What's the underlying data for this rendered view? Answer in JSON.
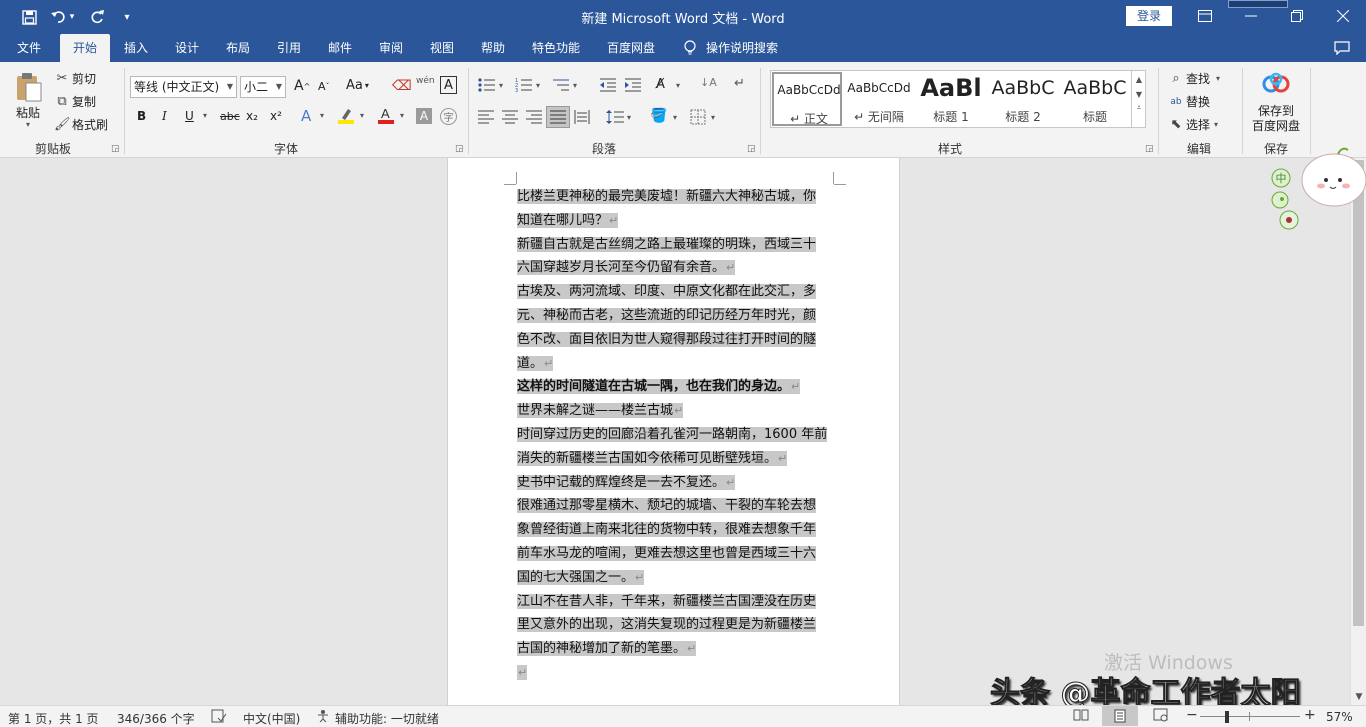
{
  "titlebar": {
    "title": "新建 Microsoft Word 文档  -  Word",
    "login": "登录",
    "customize": "▾"
  },
  "tabs": [
    "文件",
    "开始",
    "插入",
    "设计",
    "布局",
    "引用",
    "邮件",
    "审阅",
    "视图",
    "帮助",
    "特色功能",
    "百度网盘"
  ],
  "tell_me": "操作说明搜索",
  "ribbon": {
    "clipboard": {
      "paste": "粘贴",
      "cut": "剪切",
      "copy": "复制",
      "format_painter": "格式刷",
      "label": "剪贴板"
    },
    "font": {
      "font_name": "等线 (中文正文)",
      "font_size": "小二",
      "label": "字体",
      "bold": "B",
      "italic": "I",
      "underline": "U",
      "strike": "abc",
      "sub": "x₂",
      "sup": "x²",
      "case": "Aa",
      "grow": "A",
      "shrink": "A",
      "phonetic": "wén",
      "border_char": "A"
    },
    "paragraph": {
      "label": "段落"
    },
    "styles": {
      "label": "样式",
      "items": [
        {
          "sample": "AaBbCcDd",
          "name": "↵ 正文"
        },
        {
          "sample": "AaBbCcDd",
          "name": "↵ 无间隔"
        },
        {
          "sample": "AaBl",
          "name": "标题 1"
        },
        {
          "sample": "AaBbC",
          "name": "标题 2"
        },
        {
          "sample": "AaBbC",
          "name": "标题"
        }
      ]
    },
    "editing": {
      "label": "编辑",
      "find": "查找",
      "replace": "替换",
      "select": "选择"
    },
    "save": {
      "label": "保存",
      "button": "保存到\n百度网盘",
      "line1": "保存到",
      "line2": "百度网盘"
    }
  },
  "document": {
    "paragraphs": [
      {
        "lines": [
          "比楼兰更神秘的最完美废墟！新疆六大神秘古城，你",
          "知道在哪儿吗？"
        ],
        "bold": false
      },
      {
        "lines": [
          "新疆自古就是古丝绸之路上最璀璨的明珠，西域三十",
          "六国穿越岁月长河至今仍留有余音。"
        ],
        "bold": false
      },
      {
        "lines": [
          "古埃及、两河流域、印度、中原文化都在此交汇，多",
          "元、神秘而古老，这些流逝的印记历经万年时光，颜",
          "色不改、面目依旧为世人窥得那段过往打开时间的隧",
          "道。"
        ],
        "bold": false
      },
      {
        "lines": [
          "这样的时间隧道在古城一隅，也在我们的身边。"
        ],
        "bold": true
      },
      {
        "lines": [
          "世界未解之谜——楼兰古城"
        ],
        "bold": false
      },
      {
        "lines": [
          "时间穿过历史的回廊沿着孔雀河一路朝南，1600 年前",
          "消失的新疆楼兰古国如今依稀可见断壁残垣。"
        ],
        "bold": false
      },
      {
        "lines": [
          "史书中记载的辉煌终是一去不复还。"
        ],
        "bold": false
      },
      {
        "lines": [
          "很难通过那零星横木、颓圮的城墙、干裂的车轮去想",
          "象曾经街道上南来北往的货物中转，很难去想象千年",
          "前车水马龙的喧闹，更难去想这里也曾是西域三十六",
          "国的七大强国之一。"
        ],
        "bold": false
      },
      {
        "lines": [
          "江山不在昔人非，千年来，新疆楼兰古国湮没在历史",
          "里又意外的出现，这消失复现的过程更是为新疆楼兰",
          "古国的神秘增加了新的笔墨。"
        ],
        "bold": false
      },
      {
        "lines": [
          ""
        ],
        "bold": false
      }
    ],
    "para_mark": "↵"
  },
  "watermarks": {
    "activate": "激活 Windows",
    "toutiao": "头条 @革命工作者太阳"
  },
  "mascot_text": "中",
  "statusbar": {
    "page": "第 1 页，共 1 页",
    "words": "346/366 个字",
    "language": "中文(中国)",
    "accessibility": "辅助功能: 一切就绪",
    "zoom": "57%",
    "zoom_minus": "−",
    "zoom_plus": "+"
  }
}
